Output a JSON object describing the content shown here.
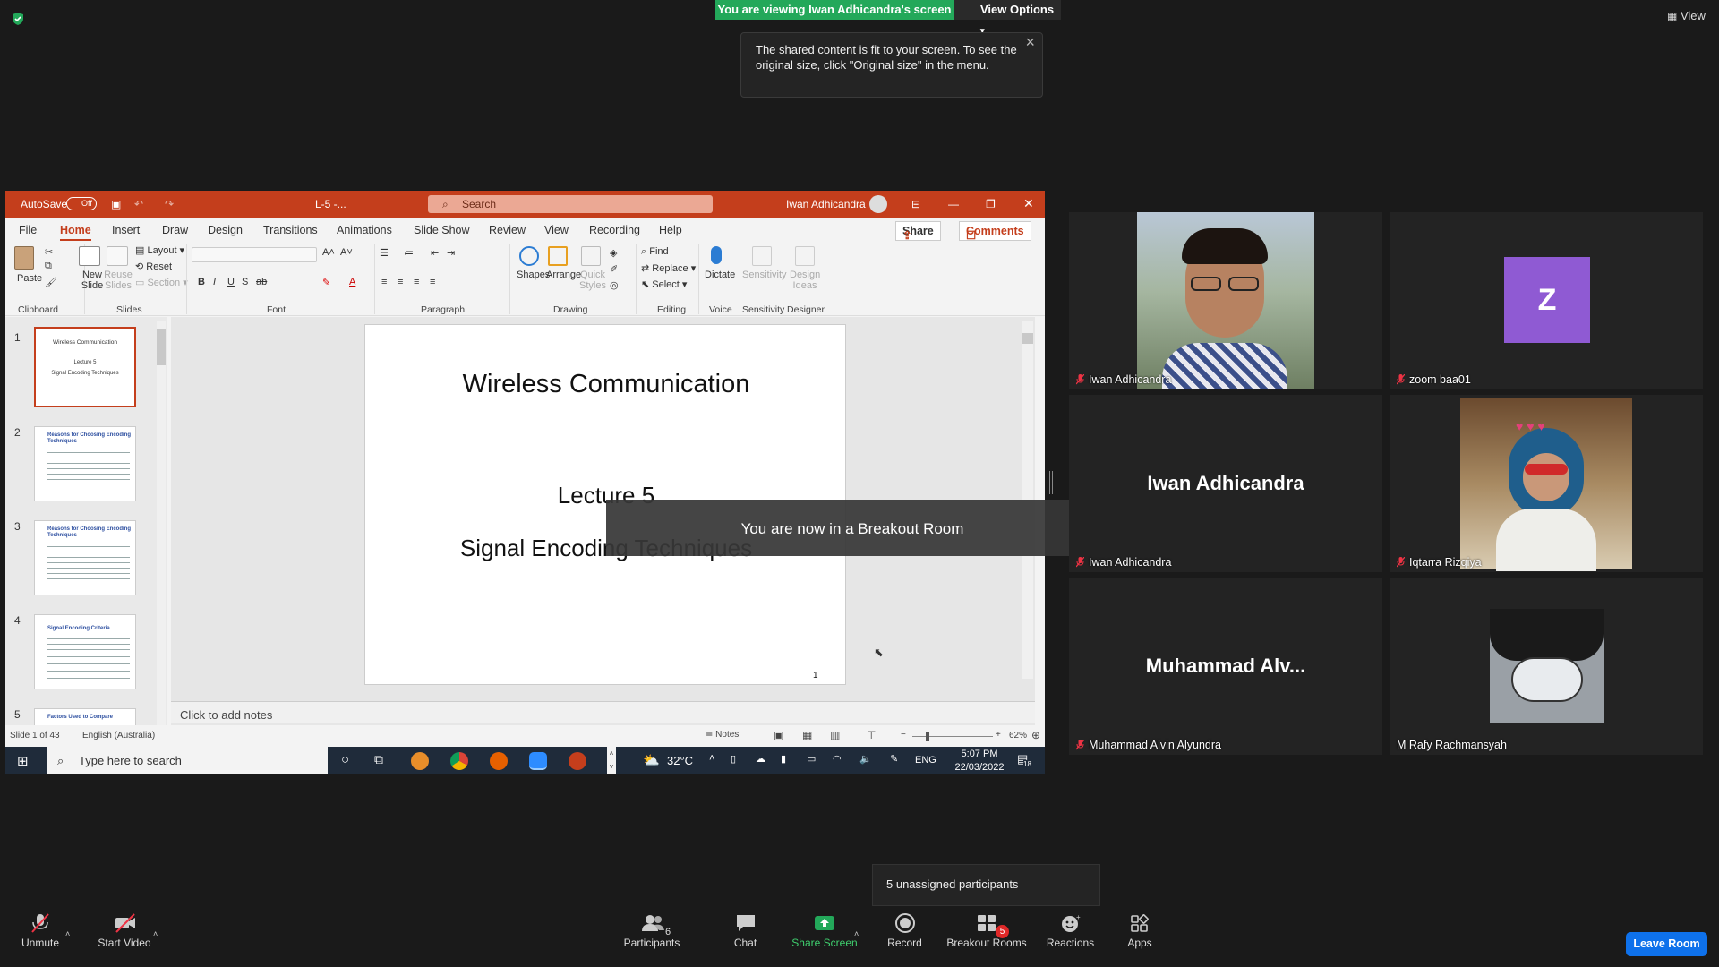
{
  "zoom": {
    "banner": "You are viewing Iwan Adhicandra's screen",
    "view_options": "View Options",
    "tooltip": "The shared content is fit to your screen. To see the original size, click \"Original size\" in the menu.",
    "view": "View",
    "overlay": "You are now in a Breakout Room",
    "unassigned": "5 unassigned participants",
    "toolbar": {
      "unmute": "Unmute",
      "start_video": "Start Video",
      "participants": "Participants",
      "participants_count": "6",
      "chat": "Chat",
      "share_screen": "Share Screen",
      "record": "Record",
      "breakout_rooms": "Breakout Rooms",
      "breakout_badge": "5",
      "reactions": "Reactions",
      "apps": "Apps",
      "leave": "Leave Room"
    },
    "tiles": [
      {
        "name": "Iwan Adhicandra",
        "big": "",
        "muted": true
      },
      {
        "name": "zoom baa01",
        "letter": "Z",
        "muted": true
      },
      {
        "name": "Iwan Adhicandra",
        "big": "Iwan Adhicandra",
        "muted": true
      },
      {
        "name": "Iqtarra Rizqiya",
        "muted": true
      },
      {
        "name": "Muhammad Alvin Alyundra",
        "big": "Muhammad  Alv...",
        "muted": true
      },
      {
        "name": "M Rafy Rachmansyah",
        "muted": false
      }
    ]
  },
  "ppt": {
    "autosave": "AutoSave",
    "autosave_state": "Off",
    "filename": "L-5 -...",
    "search": "Search",
    "user": "Iwan Adhicandra",
    "menu": [
      "File",
      "Home",
      "Insert",
      "Draw",
      "Design",
      "Transitions",
      "Animations",
      "Slide Show",
      "Review",
      "View",
      "Recording",
      "Help"
    ],
    "share": "Share",
    "comments": "Comments",
    "ribbon": {
      "paste": "Paste",
      "new_slide": "New Slide",
      "reuse_slides": "Reuse Slides",
      "layout": "Layout",
      "reset": "Reset",
      "section": "Section",
      "shapes": "Shapes",
      "arrange": "Arrange",
      "quick_styles": "Quick Styles",
      "find": "Find",
      "replace": "Replace",
      "select": "Select",
      "dictate": "Dictate",
      "sensitivity": "Sensitivity",
      "design_ideas": "Design Ideas",
      "groups": [
        "Clipboard",
        "Slides",
        "Font",
        "Paragraph",
        "Drawing",
        "Editing",
        "Voice",
        "Sensitivity",
        "Designer"
      ]
    },
    "thumbs": [
      {
        "num": "1",
        "title": "Wireless Communication",
        "sub1": "Lecture 5",
        "sub2": "Signal Encoding Techniques"
      },
      {
        "num": "2",
        "title": "Reasons for Choosing Encoding Techniques"
      },
      {
        "num": "3",
        "title": "Reasons for Choosing Encoding Techniques"
      },
      {
        "num": "4",
        "title": "Signal Encoding Criteria"
      },
      {
        "num": "5",
        "title": "Factors Used to Compare"
      }
    ],
    "slide": {
      "title": "Wireless Communication",
      "lecture": "Lecture 5",
      "subtitle": "Signal Encoding Techniques",
      "page": "1"
    },
    "notes": "Click to add notes",
    "status": {
      "slide": "Slide 1 of 43",
      "lang": "English (Australia)",
      "notes_btn": "Notes",
      "zoom": "62%"
    },
    "taskbar": {
      "search": "Type here to search",
      "temp": "32°C",
      "lang": "ENG",
      "time": "5:07 PM",
      "date": "22/03/2022",
      "notif": "18"
    }
  }
}
